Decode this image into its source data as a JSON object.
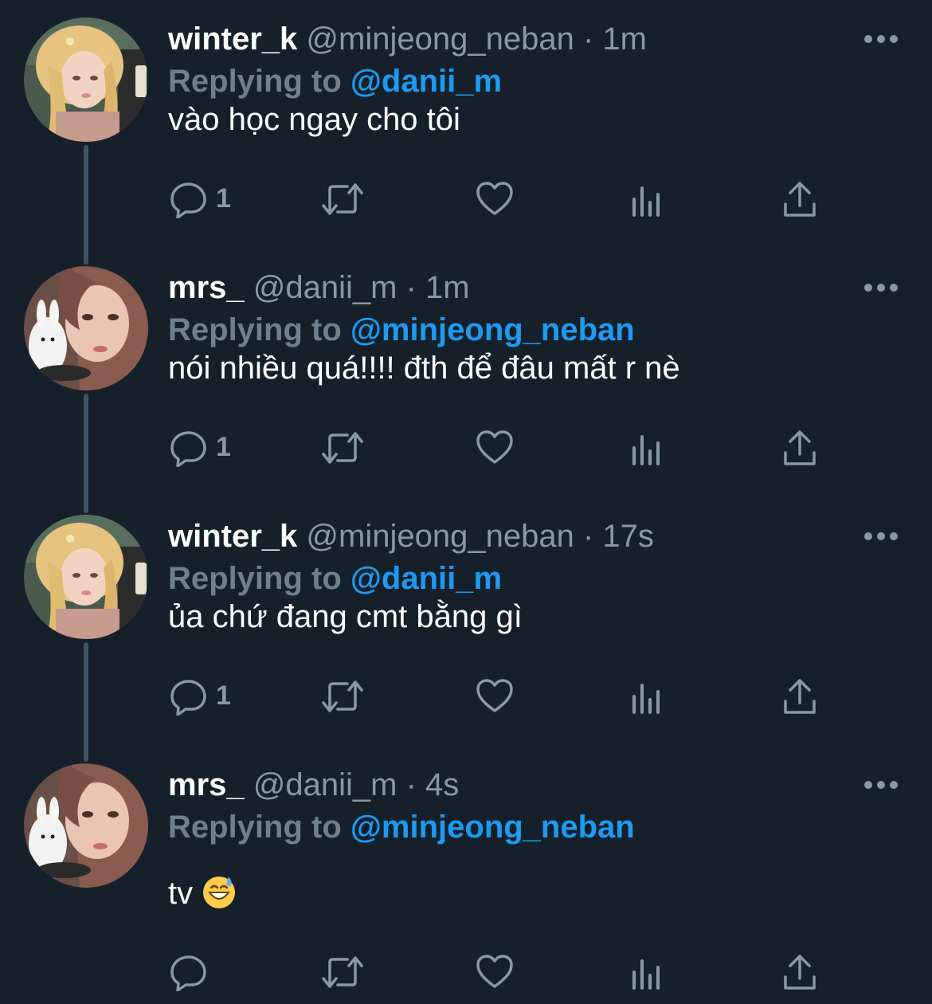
{
  "colors": {
    "background": "#15202b",
    "secondary_text": "#8899a6",
    "mention": "#1d9bf0",
    "thread_line": "#3d5466"
  },
  "tweets": [
    {
      "display_name": "winter_k",
      "handle": "@minjeong_neban",
      "separator": "·",
      "time": "1m",
      "reply_prefix": "Replying to",
      "reply_to": "@danii_m",
      "text": "vào học ngay cho tôi",
      "reply_count": "1",
      "avatar": "blonde-avatar"
    },
    {
      "display_name": "mrs_",
      "handle": "@danii_m",
      "separator": "·",
      "time": "1m",
      "reply_prefix": "Replying to",
      "reply_to": "@minjeong_neban",
      "text": "nói nhiều quá!!!! đth để đâu mất r nè",
      "reply_count": "1",
      "avatar": "brunette-avatar"
    },
    {
      "display_name": "winter_k",
      "handle": "@minjeong_neban",
      "separator": "·",
      "time": "17s",
      "reply_prefix": "Replying to",
      "reply_to": "@danii_m",
      "text": "ủa chứ đang cmt bằng gì",
      "reply_count": "1",
      "avatar": "blonde-avatar"
    },
    {
      "display_name": "mrs_",
      "handle": "@danii_m",
      "separator": "·",
      "time": "4s",
      "reply_prefix": "Replying to",
      "reply_to": "@minjeong_neban",
      "text": "tv",
      "emoji": "grinning-sweat-emoji",
      "reply_count": "",
      "avatar": "brunette-avatar"
    }
  ],
  "icons": {
    "more": "more-icon",
    "reply": "reply-icon",
    "retweet": "retweet-icon",
    "like": "like-icon",
    "views": "views-icon",
    "share": "share-icon"
  }
}
